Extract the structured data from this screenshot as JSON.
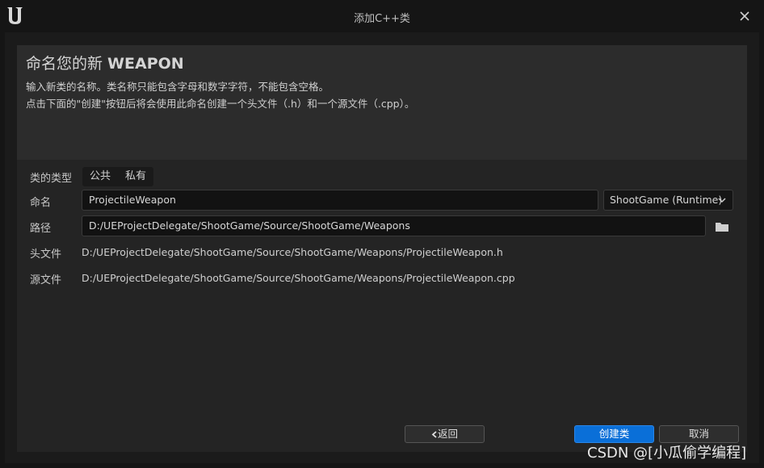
{
  "window": {
    "title": "添加C++类",
    "logo_icon": "unreal-engine-logo-icon",
    "close_icon": "close-icon"
  },
  "header": {
    "heading_prefix": "命名您的新 ",
    "heading_class": "WEAPON",
    "desc_line1": "输入新类的名称。类名称只能包含字母和数字字符，不能包含空格。",
    "desc_line2": "点击下面的\"创建\"按钮后将会使用此命名创建一个头文件（.h）和一个源文件（.cpp）。"
  },
  "form": {
    "class_type_label": "类的类型",
    "class_type_options": [
      "公共",
      "私有"
    ],
    "name_label": "命名",
    "name_value": "ProjectileWeapon",
    "module_value": "ShootGame (Runtime)",
    "path_label": "路径",
    "path_value": "D:/UEProjectDelegate/ShootGame/Source/ShootGame/Weapons",
    "header_label": "头文件",
    "header_value": "D:/UEProjectDelegate/ShootGame/Source/ShootGame/Weapons/ProjectileWeapon.h",
    "source_label": "源文件",
    "source_value": "D:/UEProjectDelegate/ShootGame/Source/ShootGame/Weapons/ProjectileWeapon.cpp"
  },
  "buttons": {
    "back": "返回",
    "create": "创建类",
    "cancel": "取消"
  },
  "watermark": "CSDN @[小瓜偷学编程]",
  "colors": {
    "accent": "#0a6fd8",
    "background": "#151515",
    "panel": "#242424"
  }
}
